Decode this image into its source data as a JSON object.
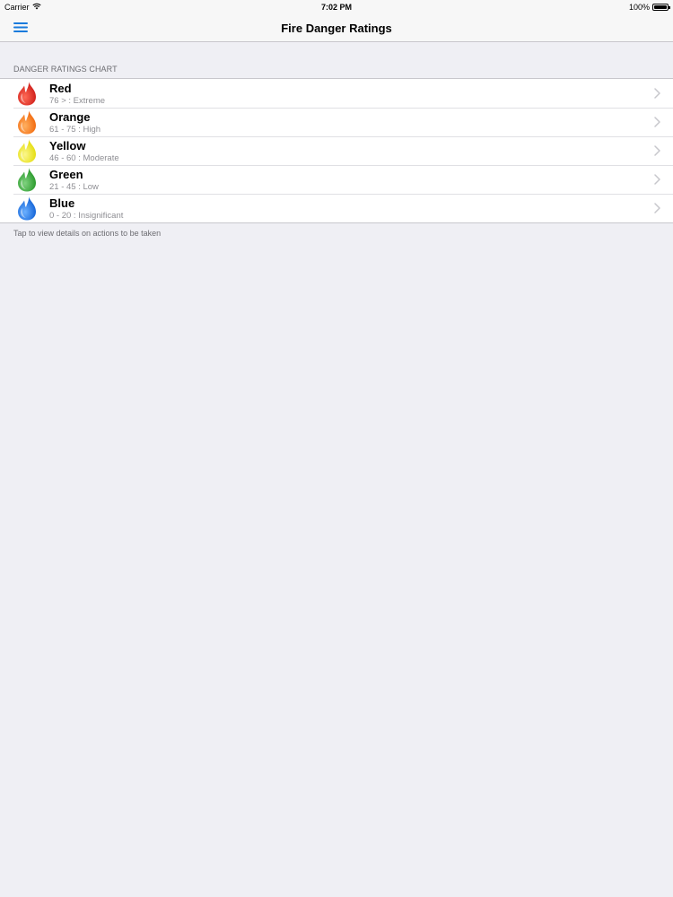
{
  "status_bar": {
    "carrier": "Carrier",
    "time": "7:02 PM",
    "battery": "100%"
  },
  "nav": {
    "title": "Fire Danger Ratings",
    "menu_icon": "hamburger-menu-icon"
  },
  "section": {
    "header": "DANGER RATINGS CHART",
    "footer": "Tap to view details on actions to be taken"
  },
  "ratings": [
    {
      "title": "Red",
      "subtitle": "76 > : Extreme",
      "color": "#d0201c",
      "light": "#ff6a55"
    },
    {
      "title": "Orange",
      "subtitle": "61 - 75 : High",
      "color": "#f26b10",
      "light": "#ffb060"
    },
    {
      "title": "Yellow",
      "subtitle": "46 - 60 : Moderate",
      "color": "#e5de10",
      "light": "#fbf68c"
    },
    {
      "title": "Green",
      "subtitle": "21 - 45 : Low",
      "color": "#2b9a2c",
      "light": "#7fd27f"
    },
    {
      "title": "Blue",
      "subtitle": "0 - 20 : Insignificant",
      "color": "#1565d8",
      "light": "#6bb0ff"
    }
  ]
}
